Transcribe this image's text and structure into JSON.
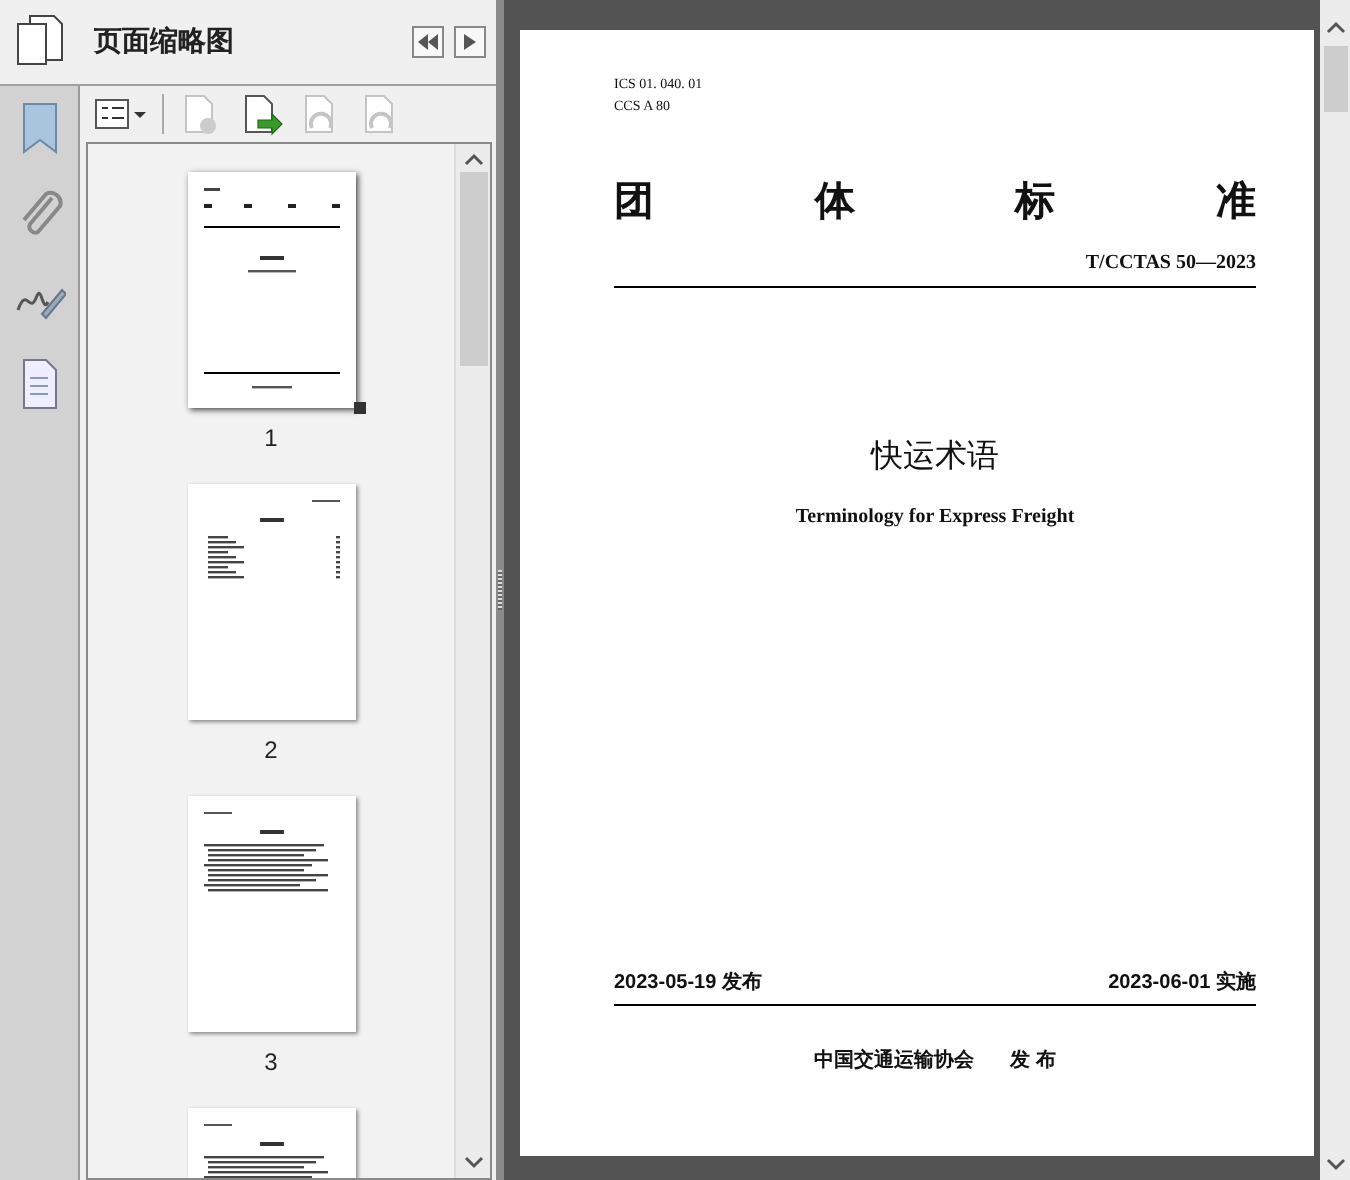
{
  "panel": {
    "title": "页面缩略图"
  },
  "toolbar": [
    {
      "kind": "delete",
      "disabled": true
    },
    {
      "kind": "insert",
      "disabled": false
    },
    {
      "kind": "rotate-left",
      "disabled": true
    },
    {
      "kind": "rotate-right",
      "disabled": true
    }
  ],
  "thumbnails": [
    {
      "kind": "cover",
      "label": "1",
      "selected": true
    },
    {
      "kind": "toc",
      "label": "2",
      "selected": false
    },
    {
      "kind": "foreword",
      "label": "3",
      "selected": false
    },
    {
      "kind": "body",
      "selected": false
    }
  ],
  "page": {
    "ics": "ICS 01. 040. 01",
    "ccs": "CCS  A 80",
    "heading_chars": [
      "团",
      "体",
      "标",
      "准"
    ],
    "code": "T/CCTAS 50—2023",
    "title": "快运术语",
    "subtitle": "Terminology for Express Freight",
    "issue_date": "2023-05-19 发布",
    "effective_date": "2023-06-01 实施",
    "publisher": "中国交通运输协会",
    "publish_word": "发 布"
  }
}
